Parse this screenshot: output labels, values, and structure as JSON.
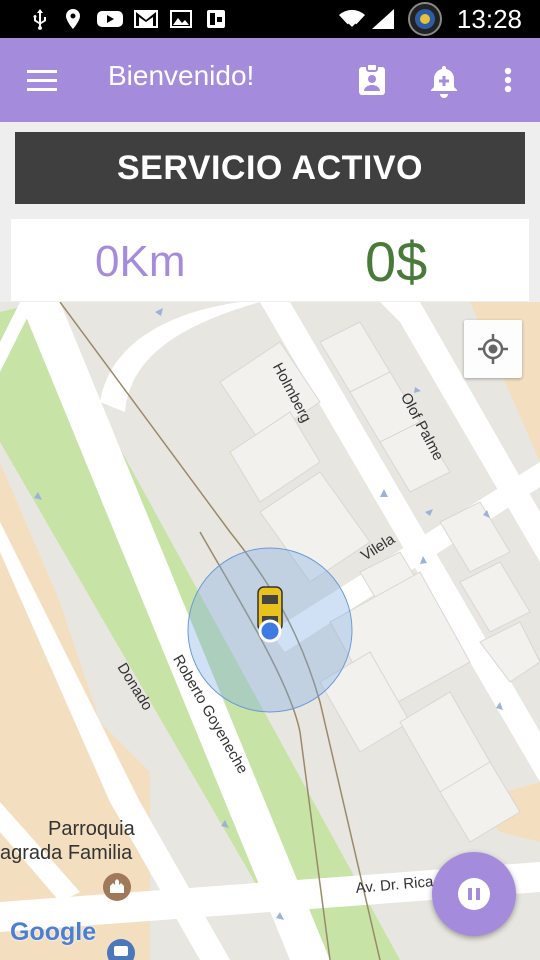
{
  "status_bar": {
    "time": "13:28",
    "icons": [
      "usb-icon",
      "location-icon",
      "youtube-icon",
      "gmail-icon",
      "gallery-icon",
      "flipboard-icon",
      "wifi-icon",
      "signal-icon",
      "camera-notification-icon"
    ]
  },
  "app_bar": {
    "title": "Bienvenido!",
    "color": "#a58bdc",
    "icons": [
      "menu-icon",
      "clipboard-icon",
      "notification-add-icon",
      "more-vert-icon"
    ]
  },
  "service_banner": {
    "text": "SERVICIO ACTIVO",
    "background": "#3f3f3f"
  },
  "stats": {
    "distance": "0Km",
    "fare": "0$",
    "distance_color": "#a58bdc",
    "fare_color": "#4a7a3a"
  },
  "map": {
    "streets": [
      "Holmberg",
      "Olof Palme",
      "Vilela",
      "Donado",
      "Roberto Goyeneche",
      "Av. Dr. Rica"
    ],
    "poi_name_line1": "Parroquia",
    "poi_name_line2": "agrada Familia",
    "provider": "Google",
    "locate_button_icon": "my-location-icon",
    "vehicle_icon": "taxi-icon"
  },
  "fab": {
    "icon": "pause-icon",
    "color": "#a58bdc"
  }
}
